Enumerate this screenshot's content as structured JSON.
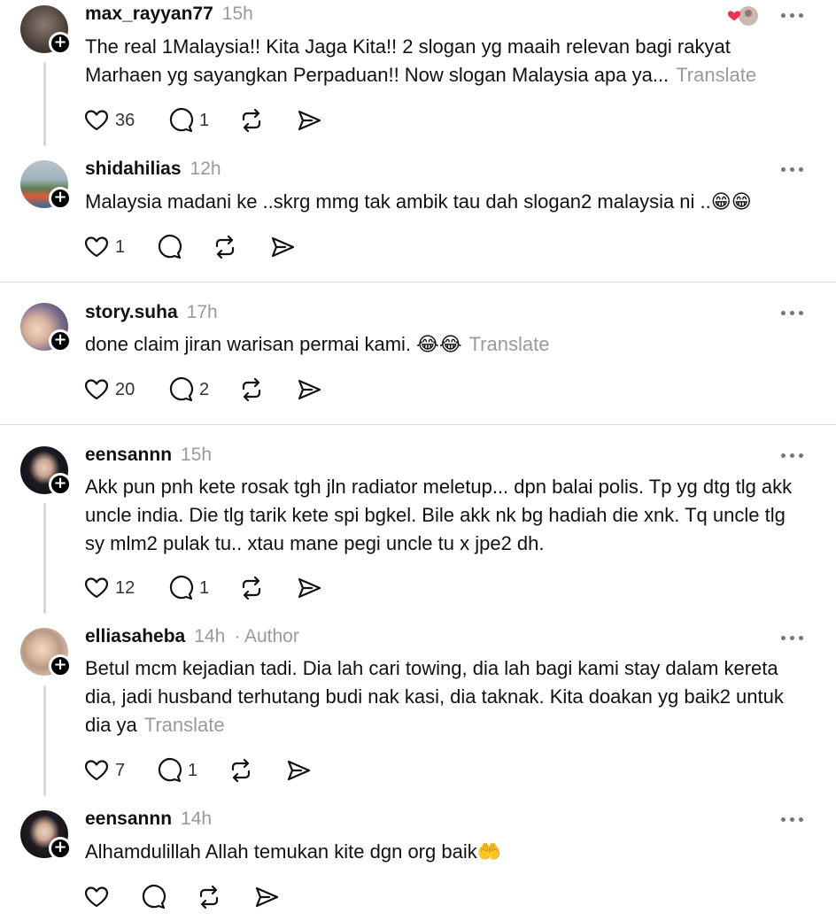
{
  "posts": [
    {
      "username": "max_rayyan77",
      "time": "15h",
      "text": "The real 1Malaysia!! Kita Jaga Kita!! 2 slogan yg maaih relevan bagi rakyat Marhaen yg sayangkan Perpaduan!! Now slogan Malaysia apa ya...",
      "translate": "Translate",
      "likes": "36",
      "replies": "1"
    },
    {
      "username": "shidahilias",
      "time": "12h",
      "text": "Malaysia madani ke ..skrg mmg tak ambik tau dah slogan2 malaysia ni ..😁😁",
      "likes": "1",
      "replies": ""
    },
    {
      "username": "story.suha",
      "time": "17h",
      "text": "done claim jiran warisan permai kami. 😂😂",
      "translate": "Translate",
      "likes": "20",
      "replies": "2"
    },
    {
      "username": "eensannn",
      "time": "15h",
      "text": "Akk pun pnh kete rosak tgh jln radiator meletup... dpn balai polis. Tp yg dtg tlg akk uncle india. Die tlg tarik kete spi bgkel. Bile akk nk bg hadiah die xnk. Tq uncle tlg sy mlm2 pulak tu.. xtau mane pegi uncle tu x jpe2 dh.",
      "likes": "12",
      "replies": "1"
    },
    {
      "username": "elliasaheba",
      "time": "14h",
      "author": "· Author",
      "text": "Betul mcm kejadian tadi. Dia lah cari towing, dia lah bagi kami stay dalam kereta dia, jadi husband terhutang budi nak kasi, dia taknak. Kita doakan yg baik2 untuk dia ya",
      "translate": "Translate",
      "likes": "7",
      "replies": "1"
    },
    {
      "username": "eensannn",
      "time": "14h",
      "text": "Alhamdulillah Allah temukan kite dgn org baik🤲",
      "likes": "",
      "replies": ""
    }
  ],
  "icons": {
    "like": "heart-icon",
    "reply": "comment-bubble-icon",
    "repost": "repost-icon",
    "share": "share-arrow-icon",
    "more": "more-dots-icon",
    "follow": "plus-icon"
  },
  "colors": {
    "liked_heart": "#e8344e",
    "muted_text": "#9a9a9a",
    "thread_line": "#d9d9d9"
  }
}
